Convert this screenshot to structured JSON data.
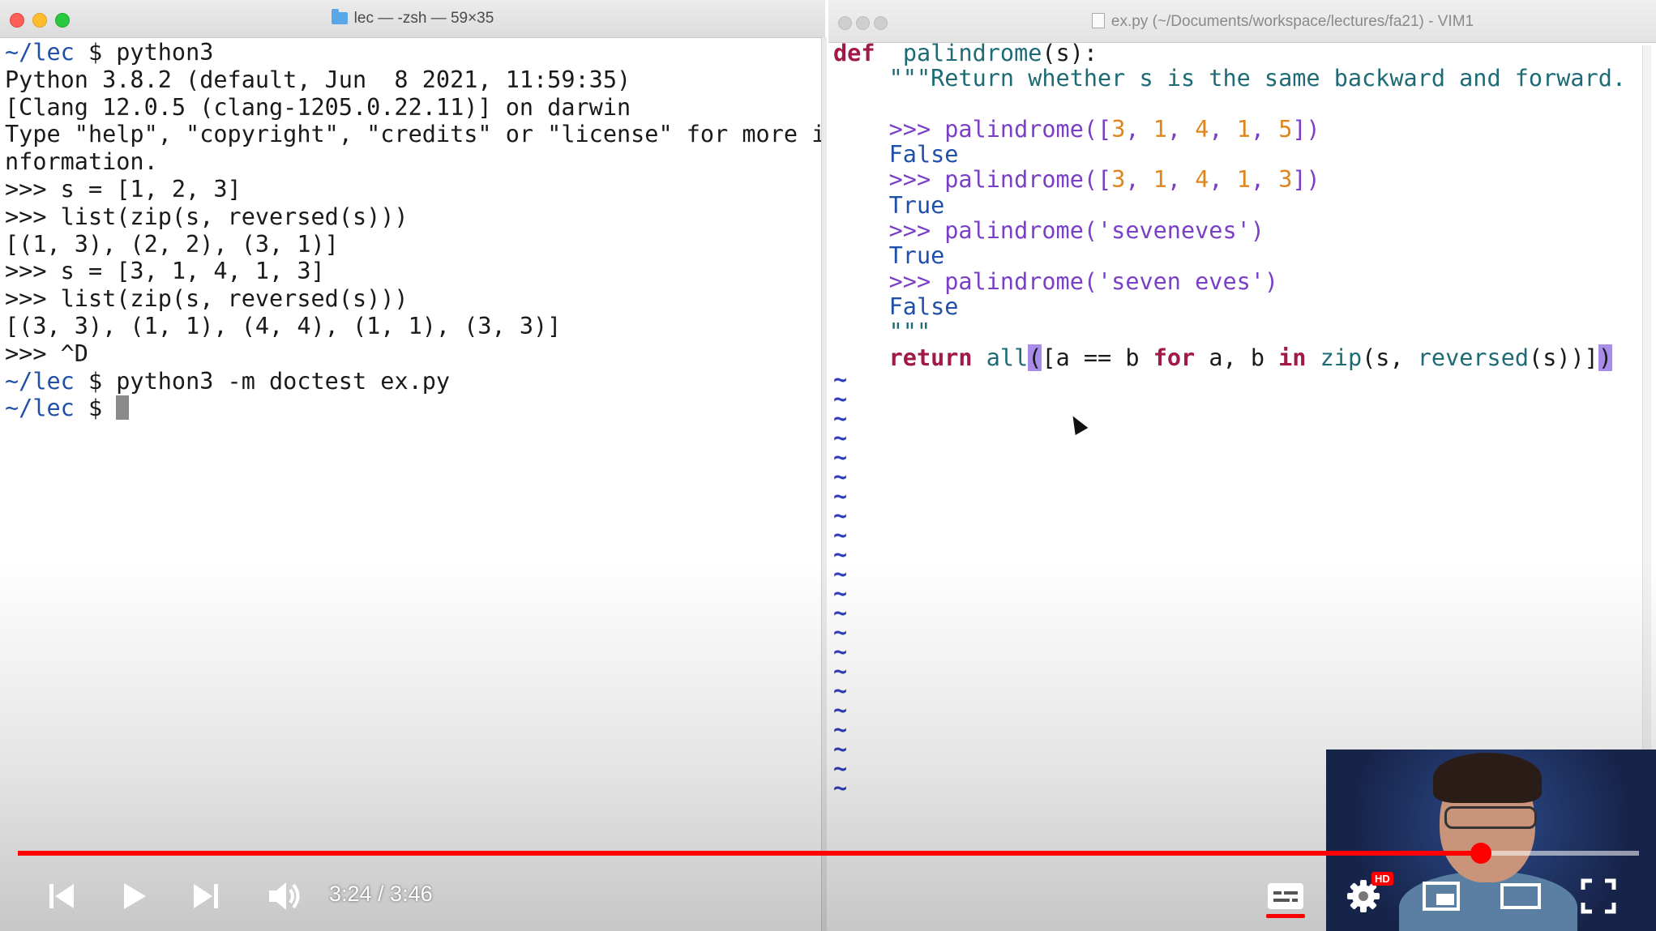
{
  "terminal": {
    "title": "lec — -zsh — 59×35",
    "lines": [
      {
        "prompt": "~/lec",
        "text": " $ python3"
      },
      {
        "prompt": "",
        "text": "Python 3.8.2 (default, Jun  8 2021, 11:59:35)"
      },
      {
        "prompt": "",
        "text": "[Clang 12.0.5 (clang-1205.0.22.11)] on darwin"
      },
      {
        "prompt": "",
        "text": "Type \"help\", \"copyright\", \"credits\" or \"license\" for more i"
      },
      {
        "prompt": "",
        "text": "nformation."
      },
      {
        "prompt": "",
        "text": ">>> s = [1, 2, 3]"
      },
      {
        "prompt": "",
        "text": ">>> list(zip(s, reversed(s)))"
      },
      {
        "prompt": "",
        "text": "[(1, 3), (2, 2), (3, 1)]"
      },
      {
        "prompt": "",
        "text": ">>> s = [3, 1, 4, 1, 3]"
      },
      {
        "prompt": "",
        "text": ">>> list(zip(s, reversed(s)))"
      },
      {
        "prompt": "",
        "text": "[(3, 3), (1, 1), (4, 4), (1, 1), (3, 3)]"
      },
      {
        "prompt": "",
        "text": ">>> ^D"
      },
      {
        "prompt": "~/lec",
        "text": " $ python3 -m doctest ex.py"
      },
      {
        "prompt": "~/lec",
        "text": " $ "
      }
    ]
  },
  "vim": {
    "title": "ex.py (~/Documents/workspace/lectures/fa21) - VIM1",
    "code": [
      [
        [
          "kw",
          "def"
        ],
        [
          "",
          "  "
        ],
        [
          "fn",
          "palindrome"
        ],
        [
          "",
          "(s):"
        ]
      ],
      [
        [
          "",
          "    "
        ],
        [
          "fn",
          "\"\"\"Return whether s is the same backward and forward."
        ]
      ],
      [
        [
          "",
          ""
        ]
      ],
      [
        [
          "",
          "    "
        ],
        [
          "str",
          ">>> palindrome(["
        ],
        [
          "num",
          "3"
        ],
        [
          "str",
          ", "
        ],
        [
          "num",
          "1"
        ],
        [
          "str",
          ", "
        ],
        [
          "num",
          "4"
        ],
        [
          "str",
          ", "
        ],
        [
          "num",
          "1"
        ],
        [
          "str",
          ", "
        ],
        [
          "num",
          "5"
        ],
        [
          "str",
          "])"
        ]
      ],
      [
        [
          "",
          "    "
        ],
        [
          "bool",
          "False"
        ]
      ],
      [
        [
          "",
          "    "
        ],
        [
          "str",
          ">>> palindrome(["
        ],
        [
          "num",
          "3"
        ],
        [
          "str",
          ", "
        ],
        [
          "num",
          "1"
        ],
        [
          "str",
          ", "
        ],
        [
          "num",
          "4"
        ],
        [
          "str",
          ", "
        ],
        [
          "num",
          "1"
        ],
        [
          "str",
          ", "
        ],
        [
          "num",
          "3"
        ],
        [
          "str",
          "])"
        ]
      ],
      [
        [
          "",
          "    "
        ],
        [
          "bool",
          "True"
        ]
      ],
      [
        [
          "",
          "    "
        ],
        [
          "str",
          ">>> palindrome('seveneves')"
        ]
      ],
      [
        [
          "",
          "    "
        ],
        [
          "bool",
          "True"
        ]
      ],
      [
        [
          "",
          "    "
        ],
        [
          "str",
          ">>> palindrome('seven eves')"
        ]
      ],
      [
        [
          "",
          "    "
        ],
        [
          "bool",
          "False"
        ]
      ],
      [
        [
          "",
          "    "
        ],
        [
          "fn",
          "\"\"\""
        ]
      ],
      [
        [
          "",
          "    "
        ],
        [
          "kw",
          "return"
        ],
        [
          "",
          " "
        ],
        [
          "fn",
          "all"
        ],
        [
          "hl",
          "("
        ],
        [
          "",
          "[a == b "
        ],
        [
          "kw",
          "for"
        ],
        [
          "",
          " a, b "
        ],
        [
          "kw",
          "in"
        ],
        [
          "",
          " "
        ],
        [
          "fn",
          "zip"
        ],
        [
          "",
          "(s, "
        ],
        [
          "fn",
          "reversed"
        ],
        [
          "",
          "(s))]"
        ],
        [
          "hl",
          ")"
        ]
      ]
    ],
    "tilde_char": "~",
    "tilde_count": 22
  },
  "player": {
    "time": "3:24 / 3:46",
    "progress": 0.9027,
    "hd_badge": "HD",
    "accent": "#ff0000"
  },
  "icons": [
    "folder-icon",
    "file-icon",
    "skip-previous-icon",
    "play-icon",
    "skip-next-icon",
    "volume-icon",
    "captions-icon",
    "settings-icon",
    "miniplayer-icon",
    "theater-mode-icon",
    "fullscreen-icon"
  ]
}
